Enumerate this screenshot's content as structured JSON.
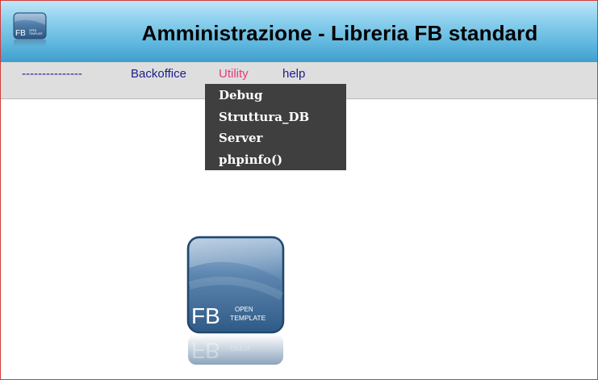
{
  "header": {
    "title": "Amministrazione - Libreria FB standard",
    "logo": {
      "brand": "FB",
      "tagline_top": "OPEN",
      "tagline_bottom": "TEMPLATE"
    }
  },
  "menu": {
    "items": [
      {
        "label": "---------------",
        "active": false
      },
      {
        "label": "Backoffice",
        "active": false
      },
      {
        "label": "Utility",
        "active": true
      },
      {
        "label": "help",
        "active": false
      }
    ]
  },
  "dropdown": {
    "items": [
      {
        "label": "Debug"
      },
      {
        "label": "Struttura_DB"
      },
      {
        "label": "Server"
      },
      {
        "label": "phpinfo()"
      }
    ]
  },
  "main": {
    "logo": {
      "brand": "FB",
      "tagline_top": "OPEN",
      "tagline_bottom": "TEMPLATE"
    }
  },
  "colors": {
    "menu_link": "#1c1c8c",
    "menu_active": "#e8397d",
    "dropdown_bg": "#3f3f3f",
    "frame_border": "#d43a3a"
  }
}
